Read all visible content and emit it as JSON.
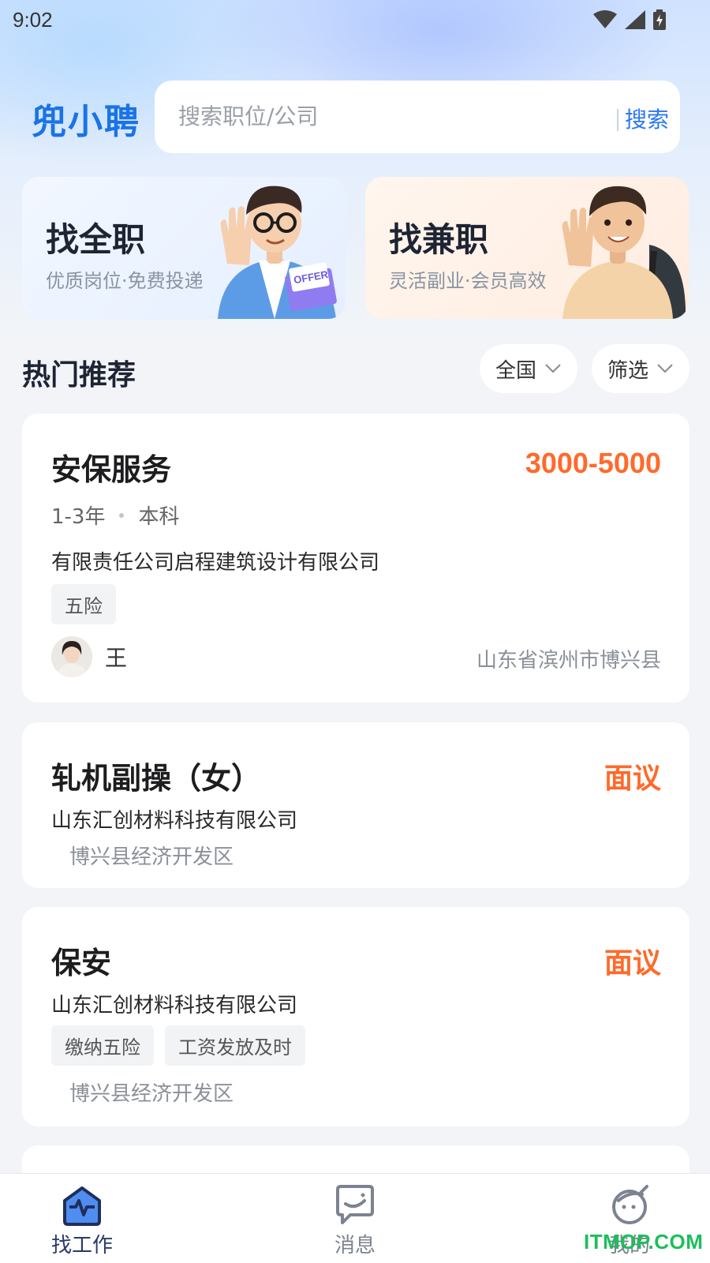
{
  "status_bar": {
    "time": "9:02"
  },
  "header": {
    "logo": "兜小聘",
    "search_placeholder": "搜索职位/公司",
    "search_button": "搜索"
  },
  "categories": [
    {
      "title": "找全职",
      "subtitle": "优质岗位·免费投递"
    },
    {
      "title": "找兼职",
      "subtitle": "灵活副业·会员高效"
    }
  ],
  "illustration_text": {
    "offer": "OFFER"
  },
  "hot": {
    "title": "热门推荐",
    "filters": [
      {
        "label": "全国"
      },
      {
        "label": "筛选"
      }
    ]
  },
  "jobs": [
    {
      "title": "安保服务",
      "salary": "3000-5000",
      "experience": "1-3年",
      "education": "本科",
      "company": "有限责任公司启程建筑设计有限公司",
      "tags": [
        "五险"
      ],
      "recruiter": "王",
      "location": "山东省滨州市博兴县"
    },
    {
      "title": "轧机副操（女）",
      "salary": "面议",
      "company": "山东汇创材料科技有限公司",
      "location": "博兴县经济开发区"
    },
    {
      "title": "保安",
      "salary": "面议",
      "company": "山东汇创材料科技有限公司",
      "tags": [
        "缴纳五险",
        "工资发放及时"
      ],
      "location": "博兴县经济开发区"
    }
  ],
  "bottom_nav": [
    {
      "label": "找工作",
      "icon": "briefcase-icon",
      "active": true
    },
    {
      "label": "消息",
      "icon": "message-icon",
      "active": false
    },
    {
      "label": "我的",
      "icon": "profile-icon",
      "active": false
    }
  ],
  "watermark": "ITMOP.COM",
  "colors": {
    "brand_blue": "#1a73e8",
    "salary_orange": "#ff6a2b",
    "watermark_green": "#1bbf5a"
  }
}
